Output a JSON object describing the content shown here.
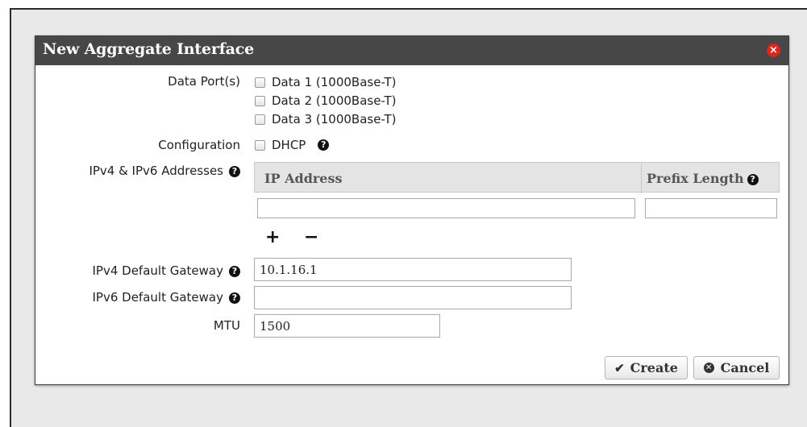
{
  "dialog": {
    "title": "New Aggregate Interface",
    "close_icon": "×"
  },
  "data_ports": {
    "label": "Data Port(s)",
    "options": [
      "Data 1 (1000Base-T)",
      "Data 2 (1000Base-T)",
      "Data 3 (1000Base-T)"
    ]
  },
  "configuration": {
    "label": "Configuration",
    "dhcp_label": "DHCP"
  },
  "ip_addresses": {
    "label": "IPv4 & IPv6 Addresses",
    "columns": [
      "IP Address",
      "Prefix Length"
    ],
    "row": {
      "ip": "",
      "prefix": ""
    },
    "add_symbol": "+",
    "remove_symbol": "−"
  },
  "ipv4_gateway": {
    "label": "IPv4 Default Gateway",
    "value": "10.1.16.1"
  },
  "ipv6_gateway": {
    "label": "IPv6 Default Gateway",
    "value": ""
  },
  "mtu": {
    "label": "MTU",
    "value": "1500"
  },
  "buttons": {
    "create": "Create",
    "cancel": "Cancel"
  },
  "icons": {
    "help": "?",
    "check": "✔",
    "cancel": "✕"
  },
  "colors": {
    "titlebar": "#474747",
    "close": "#e2231a",
    "header_bg": "#e4e4e4"
  }
}
